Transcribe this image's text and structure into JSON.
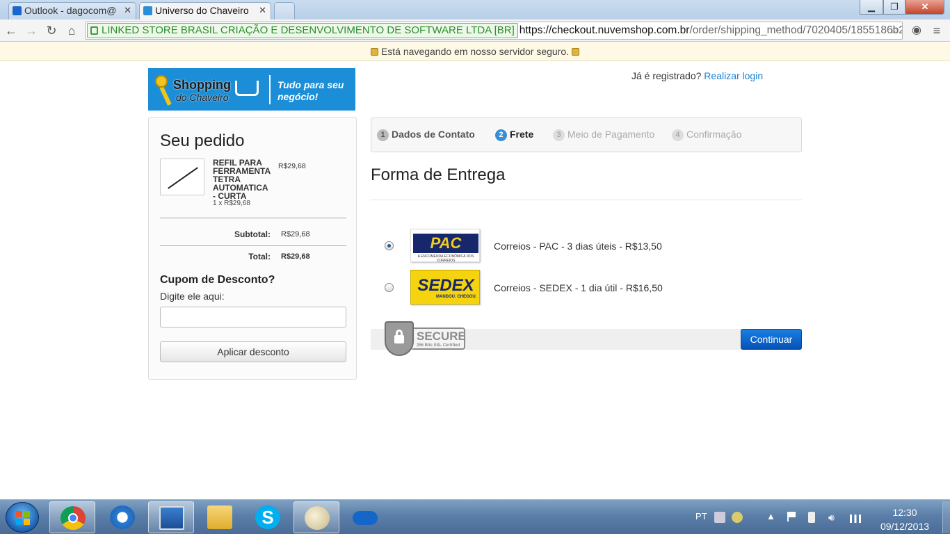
{
  "browser": {
    "tabs": [
      {
        "title": "Outlook - dagocom@",
        "active": false
      },
      {
        "title": "Universo do Chaveiro",
        "active": true
      }
    ],
    "window_buttons": {
      "minimize": "▁",
      "restore": "❐",
      "close": "✕"
    },
    "ev_cert": "LINKED STORE BRASIL CRIAÇÃO E DESENVOLVIMENTO DE SOFTWARE LTDA [BR]",
    "url_scheme_host": "https://checkout.nuvemshop.com.br",
    "url_path": "/order/shipping_method/7020405/1855186b2",
    "secure_notice": "Está navegando em nosso servidor seguro."
  },
  "header": {
    "logo": {
      "line1": "Shopping",
      "line2": "do Chaveiro",
      "tagline1": "Tudo para seu",
      "tagline2": "negócio!"
    },
    "login_prompt": "Já é registrado?",
    "login_link": "Realizar login"
  },
  "order": {
    "title": "Seu pedido",
    "item": {
      "name": "REFIL PARA FERRAMENTA TETRA AUTOMATICA - CURTA",
      "qty_line": "1 x R$29,68",
      "price": "R$29,68"
    },
    "subtotal_label": "Subtotal:",
    "subtotal_value": "R$29,68",
    "total_label": "Total:",
    "total_value": "R$29,68",
    "coupon_title": "Cupom de Desconto?",
    "coupon_label": "Digite ele aqui:",
    "coupon_value": "",
    "coupon_button": "Aplicar desconto"
  },
  "steps": [
    {
      "num": "1",
      "label": "Dados de Contato",
      "state": "done"
    },
    {
      "num": "2",
      "label": "Frete",
      "state": "current"
    },
    {
      "num": "3",
      "label": "Meio de Pagamento",
      "state": "disabled"
    },
    {
      "num": "4",
      "label": "Confirmação",
      "state": "disabled"
    }
  ],
  "shipping": {
    "title": "Forma de Entrega",
    "options": [
      {
        "logo_text": "PAC",
        "logo_sub": "A ENCOMENDA ECONÔMICA DOS CORREIOS",
        "label": "Correios - PAC - 3 dias úteis - R$13,50",
        "selected": true
      },
      {
        "logo_text": "SEDEX",
        "logo_sub": "MANDOU. CHEGOU.",
        "label": "Correios - SEDEX - 1 dia útil - R$16,50",
        "selected": false
      }
    ],
    "secure_badge": {
      "title": "SECURE",
      "subtitle": "256 Bits SSL Certified"
    },
    "continue_button": "Continuar"
  },
  "taskbar": {
    "language": "PT",
    "time": "12:30",
    "date": "09/12/2013",
    "apps": [
      "chrome-icon",
      "internet-explorer-icon",
      "remote-desktop-icon",
      "windows-explorer-icon",
      "skype-icon",
      "paint-icon",
      "skydrive-icon"
    ]
  }
}
